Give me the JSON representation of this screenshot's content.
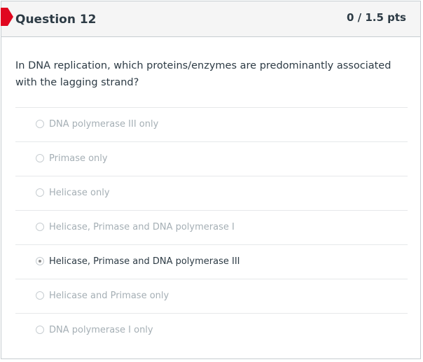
{
  "question": {
    "title": "Question 12",
    "points": "0 / 1.5 pts",
    "text": "In DNA replication, which proteins/enzymes are predominantly associated with the lagging strand?",
    "answers": [
      {
        "label": "DNA polymerase III only",
        "selected": false
      },
      {
        "label": "Primase only",
        "selected": false
      },
      {
        "label": "Helicase only",
        "selected": false
      },
      {
        "label": "Helicase, Primase and DNA polymerase I",
        "selected": false
      },
      {
        "label": "Helicase, Primase and DNA polymerase III",
        "selected": true
      },
      {
        "label": "Helicase and Primase only",
        "selected": false
      },
      {
        "label": "DNA polymerase I only",
        "selected": false
      }
    ]
  },
  "colors": {
    "flag": "#e0061f",
    "header_bg": "#f5f5f5",
    "text": "#2d3b45",
    "muted": "#a5afb5"
  }
}
